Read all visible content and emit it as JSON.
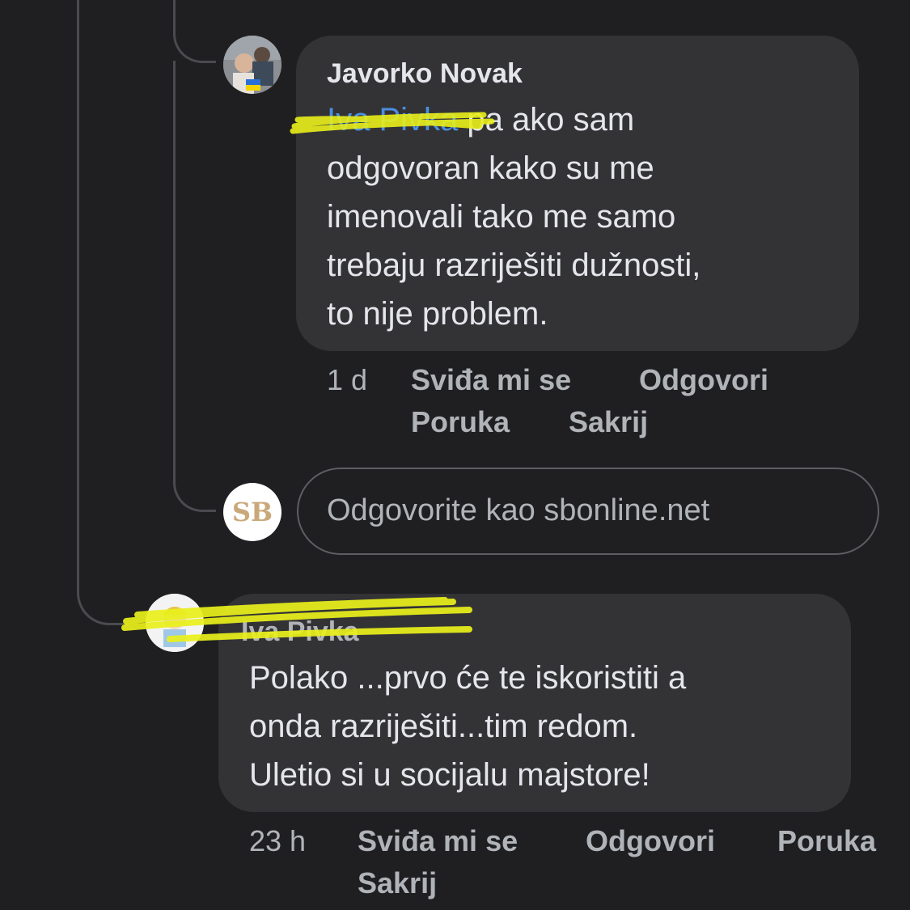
{
  "comment1": {
    "author": "Javorko Novak",
    "mention": "Iva Pivka",
    "text_line1": "pa ako sam",
    "text_line2": "odgovoran kako su me",
    "text_line3": "imenovali tako me samo",
    "text_line4": "trebaju razriješiti dužnosti,",
    "text_line5": "to nije problem.",
    "time": "1 d",
    "actions": {
      "like": "Sviđa mi se",
      "reply": "Odgovori",
      "message": "Poruka",
      "hide": "Sakrij"
    },
    "avatar_flag": "ukraine-flag"
  },
  "reply_box": {
    "avatar_text": "SB",
    "placeholder": "Odgovorite kao sbonline.net"
  },
  "comment2": {
    "author": "Iva Pivka",
    "text_line1": "Polako ...prvo će te iskoristiti a",
    "text_line2": "onda razriješiti...tim redom.",
    "text_line3": "Uletio si u socijalu majstore!",
    "time": "23 h",
    "actions": {
      "like": "Sviđa mi se",
      "reply": "Odgovori",
      "message": "Poruka",
      "hide": "Sakrij"
    }
  },
  "colors": {
    "background": "#1f1f21",
    "bubble": "#333336",
    "mention": "#4b8fe0",
    "highlighter": "#e9f01a",
    "sb_logo": "#c9a97a"
  }
}
